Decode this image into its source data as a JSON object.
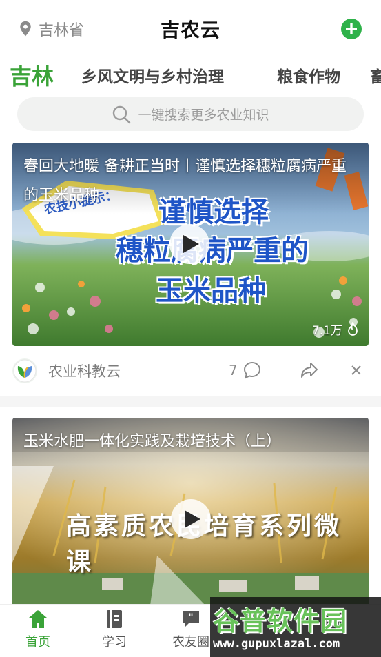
{
  "header": {
    "location": "吉林省",
    "title": "吉农云"
  },
  "tabs": [
    {
      "label": "吉林",
      "active": true
    },
    {
      "label": "乡风文明与乡村治理",
      "active": false
    },
    {
      "label": "粮食作物",
      "active": false
    },
    {
      "label": "畜",
      "active": false
    }
  ],
  "search": {
    "placeholder": "一键搜索更多农业知识"
  },
  "feed": [
    {
      "title": "春回大地暖 备耕正当时丨谨慎选择穗粒腐病严重的玉米品种",
      "poster_text": [
        "谨慎选择",
        "穗粒腐病严重的",
        "玉米品种"
      ],
      "badge_text": "农技小提示：",
      "views": "7.1万",
      "author": "农业科教云",
      "comments": "7"
    },
    {
      "title": "玉米水肥一体化实践及栽培技术（上）",
      "poster_text": "高素质农民培育系列微课"
    }
  ],
  "bottom_nav": [
    {
      "label": "首页",
      "icon": "home-icon",
      "active": true
    },
    {
      "label": "学习",
      "icon": "book-icon",
      "active": false
    },
    {
      "label": "农友圈",
      "icon": "chat-icon",
      "active": false
    }
  ],
  "watermark": {
    "main": "谷普软件园",
    "url": "www.gupuxlazal.com"
  },
  "colors": {
    "brand_green": "#3aa338",
    "add_button": "#2fb24a"
  }
}
